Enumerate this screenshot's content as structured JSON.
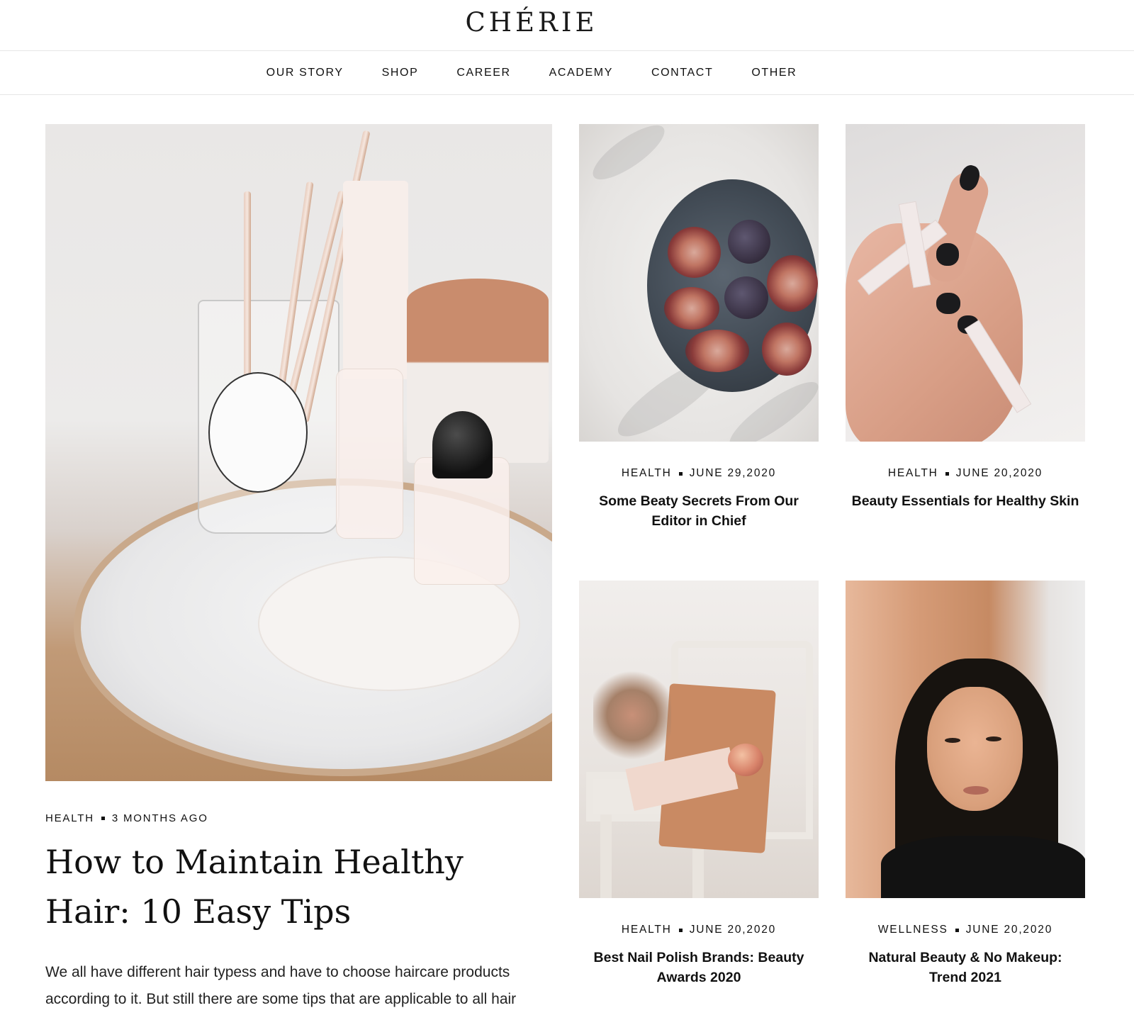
{
  "brand": {
    "logo_text": "CHÉRIE"
  },
  "nav": {
    "items": [
      {
        "label": "OUR STORY"
      },
      {
        "label": "SHOP"
      },
      {
        "label": "CAREER"
      },
      {
        "label": "ACADEMY"
      },
      {
        "label": "CONTACT"
      },
      {
        "label": "OTHER"
      }
    ]
  },
  "featured": {
    "category": "HEALTH",
    "date": "3 MONTHS AGO",
    "title": "How to Maintain Healthy Hair: 10 Easy Tips",
    "excerpt": "We all have different hair typess and have to choose haircare products according to it. But still there are some tips that are applicable to all hair"
  },
  "posts": [
    {
      "category": "HEALTH",
      "date": "JUNE 29,2020",
      "title": "Some Beaty Secrets From Our Editor in Chief",
      "image": "figs-on-plate"
    },
    {
      "category": "HEALTH",
      "date": "JUNE 20,2020",
      "title": "Beauty Essentials for Healthy Skin",
      "image": "hand-with-ribbon"
    },
    {
      "category": "HEALTH",
      "date": "JUNE 20,2020",
      "title": "Best Nail Polish Brands: Beauty Awards 2020",
      "image": "chair-with-bag"
    },
    {
      "category": "WELLNESS",
      "date": "JUNE 20,2020",
      "title": "Natural Beauty & No Makeup: Trend 2021",
      "image": "woman-portrait"
    }
  ],
  "colors": {
    "text": "#111111",
    "divider": "#e6e6e6",
    "background": "#ffffff"
  }
}
